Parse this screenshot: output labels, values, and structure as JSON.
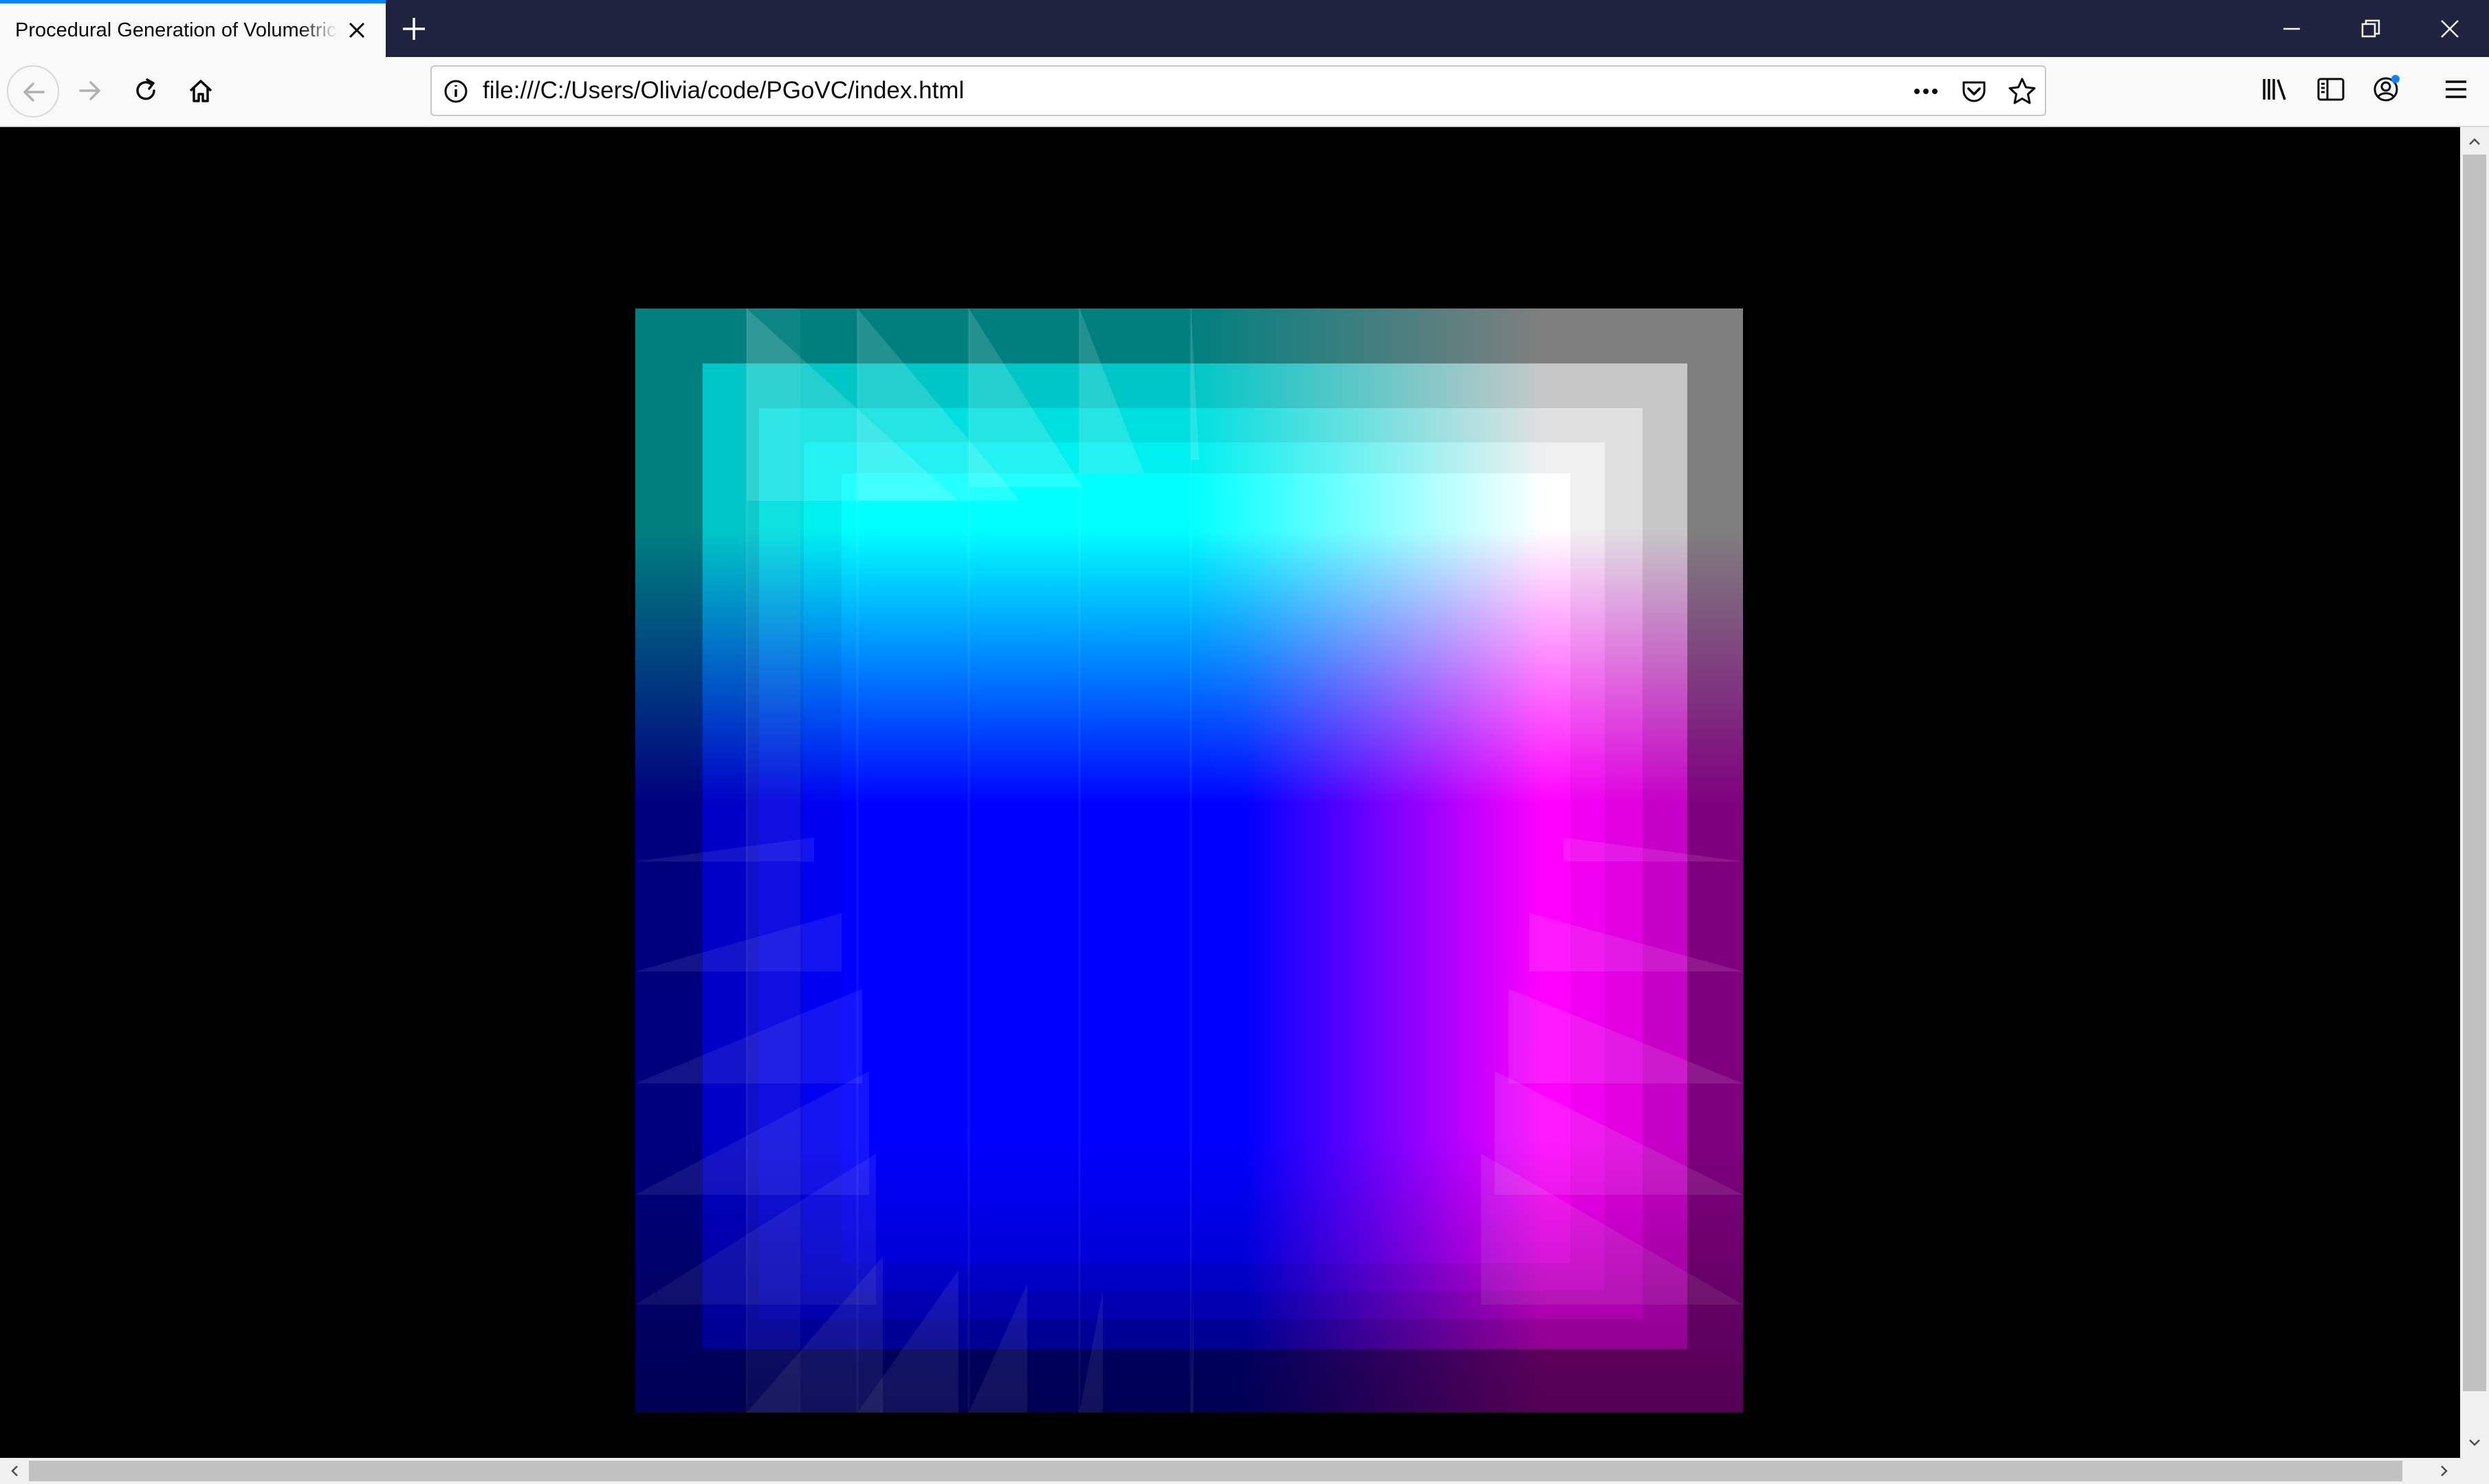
{
  "window": {
    "tab_title": "Procedural Generation of Volumetric Clouds",
    "new_tab_symbol": "+",
    "controls": [
      "minimize-icon",
      "restore-icon",
      "close-icon"
    ]
  },
  "toolbar": {
    "nav_icons": [
      "back-arrow-icon",
      "forward-arrow-icon",
      "reload-icon",
      "home-icon"
    ],
    "url": "file:///C:/Users/Olivia/code/PGoVC/index.html",
    "url_icons": [
      "site-info-icon",
      "page-actions-icon",
      "pocket-icon",
      "bookmark-star-icon"
    ],
    "right_icons": [
      "library-icon",
      "sidebar-icon",
      "account-icon",
      "menu-icon"
    ],
    "account_badge_color": "#0a84ff"
  },
  "render": {
    "background": "#000000",
    "corner_colors": {
      "top_left": "#00ffff",
      "top_right": "#ffffff",
      "bottom_left": "#0000ff",
      "bottom_right": "#ff00ff"
    }
  }
}
